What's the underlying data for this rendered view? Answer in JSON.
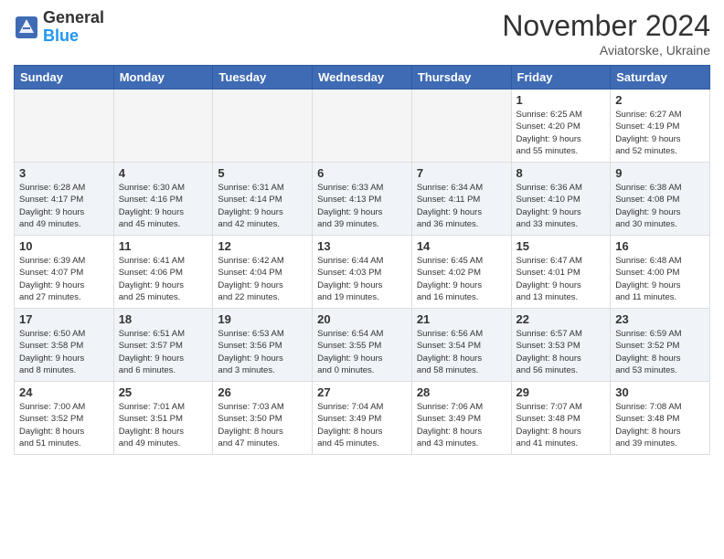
{
  "logo": {
    "general": "General",
    "blue": "Blue"
  },
  "title": "November 2024",
  "location": "Aviatorske, Ukraine",
  "days_of_week": [
    "Sunday",
    "Monday",
    "Tuesday",
    "Wednesday",
    "Thursday",
    "Friday",
    "Saturday"
  ],
  "weeks": [
    [
      {
        "day": "",
        "info": ""
      },
      {
        "day": "",
        "info": ""
      },
      {
        "day": "",
        "info": ""
      },
      {
        "day": "",
        "info": ""
      },
      {
        "day": "",
        "info": ""
      },
      {
        "day": "1",
        "info": "Sunrise: 6:25 AM\nSunset: 4:20 PM\nDaylight: 9 hours\nand 55 minutes."
      },
      {
        "day": "2",
        "info": "Sunrise: 6:27 AM\nSunset: 4:19 PM\nDaylight: 9 hours\nand 52 minutes."
      }
    ],
    [
      {
        "day": "3",
        "info": "Sunrise: 6:28 AM\nSunset: 4:17 PM\nDaylight: 9 hours\nand 49 minutes."
      },
      {
        "day": "4",
        "info": "Sunrise: 6:30 AM\nSunset: 4:16 PM\nDaylight: 9 hours\nand 45 minutes."
      },
      {
        "day": "5",
        "info": "Sunrise: 6:31 AM\nSunset: 4:14 PM\nDaylight: 9 hours\nand 42 minutes."
      },
      {
        "day": "6",
        "info": "Sunrise: 6:33 AM\nSunset: 4:13 PM\nDaylight: 9 hours\nand 39 minutes."
      },
      {
        "day": "7",
        "info": "Sunrise: 6:34 AM\nSunset: 4:11 PM\nDaylight: 9 hours\nand 36 minutes."
      },
      {
        "day": "8",
        "info": "Sunrise: 6:36 AM\nSunset: 4:10 PM\nDaylight: 9 hours\nand 33 minutes."
      },
      {
        "day": "9",
        "info": "Sunrise: 6:38 AM\nSunset: 4:08 PM\nDaylight: 9 hours\nand 30 minutes."
      }
    ],
    [
      {
        "day": "10",
        "info": "Sunrise: 6:39 AM\nSunset: 4:07 PM\nDaylight: 9 hours\nand 27 minutes."
      },
      {
        "day": "11",
        "info": "Sunrise: 6:41 AM\nSunset: 4:06 PM\nDaylight: 9 hours\nand 25 minutes."
      },
      {
        "day": "12",
        "info": "Sunrise: 6:42 AM\nSunset: 4:04 PM\nDaylight: 9 hours\nand 22 minutes."
      },
      {
        "day": "13",
        "info": "Sunrise: 6:44 AM\nSunset: 4:03 PM\nDaylight: 9 hours\nand 19 minutes."
      },
      {
        "day": "14",
        "info": "Sunrise: 6:45 AM\nSunset: 4:02 PM\nDaylight: 9 hours\nand 16 minutes."
      },
      {
        "day": "15",
        "info": "Sunrise: 6:47 AM\nSunset: 4:01 PM\nDaylight: 9 hours\nand 13 minutes."
      },
      {
        "day": "16",
        "info": "Sunrise: 6:48 AM\nSunset: 4:00 PM\nDaylight: 9 hours\nand 11 minutes."
      }
    ],
    [
      {
        "day": "17",
        "info": "Sunrise: 6:50 AM\nSunset: 3:58 PM\nDaylight: 9 hours\nand 8 minutes."
      },
      {
        "day": "18",
        "info": "Sunrise: 6:51 AM\nSunset: 3:57 PM\nDaylight: 9 hours\nand 6 minutes."
      },
      {
        "day": "19",
        "info": "Sunrise: 6:53 AM\nSunset: 3:56 PM\nDaylight: 9 hours\nand 3 minutes."
      },
      {
        "day": "20",
        "info": "Sunrise: 6:54 AM\nSunset: 3:55 PM\nDaylight: 9 hours\nand 0 minutes."
      },
      {
        "day": "21",
        "info": "Sunrise: 6:56 AM\nSunset: 3:54 PM\nDaylight: 8 hours\nand 58 minutes."
      },
      {
        "day": "22",
        "info": "Sunrise: 6:57 AM\nSunset: 3:53 PM\nDaylight: 8 hours\nand 56 minutes."
      },
      {
        "day": "23",
        "info": "Sunrise: 6:59 AM\nSunset: 3:52 PM\nDaylight: 8 hours\nand 53 minutes."
      }
    ],
    [
      {
        "day": "24",
        "info": "Sunrise: 7:00 AM\nSunset: 3:52 PM\nDaylight: 8 hours\nand 51 minutes."
      },
      {
        "day": "25",
        "info": "Sunrise: 7:01 AM\nSunset: 3:51 PM\nDaylight: 8 hours\nand 49 minutes."
      },
      {
        "day": "26",
        "info": "Sunrise: 7:03 AM\nSunset: 3:50 PM\nDaylight: 8 hours\nand 47 minutes."
      },
      {
        "day": "27",
        "info": "Sunrise: 7:04 AM\nSunset: 3:49 PM\nDaylight: 8 hours\nand 45 minutes."
      },
      {
        "day": "28",
        "info": "Sunrise: 7:06 AM\nSunset: 3:49 PM\nDaylight: 8 hours\nand 43 minutes."
      },
      {
        "day": "29",
        "info": "Sunrise: 7:07 AM\nSunset: 3:48 PM\nDaylight: 8 hours\nand 41 minutes."
      },
      {
        "day": "30",
        "info": "Sunrise: 7:08 AM\nSunset: 3:48 PM\nDaylight: 8 hours\nand 39 minutes."
      }
    ]
  ]
}
